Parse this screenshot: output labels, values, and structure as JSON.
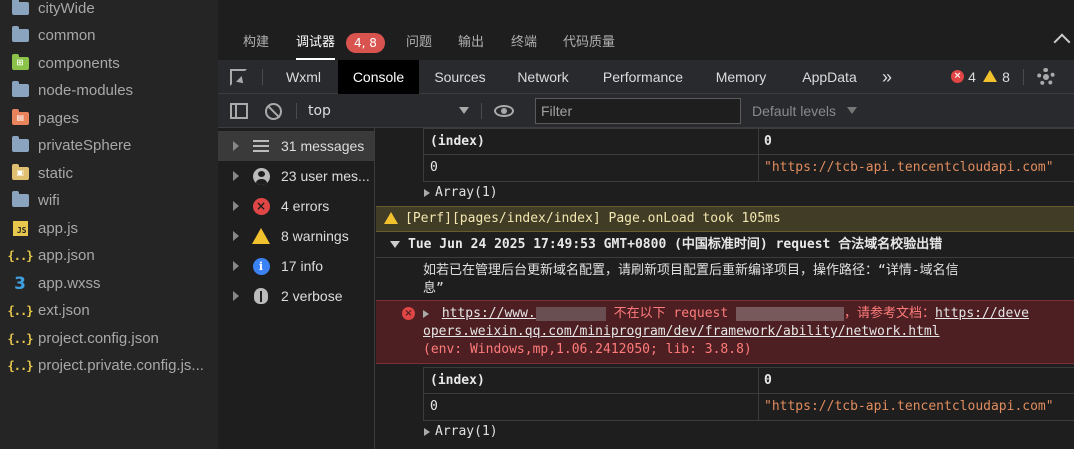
{
  "file_tree": [
    {
      "name": "cityWide",
      "icon": "folder-icon",
      "color": "blue"
    },
    {
      "name": "common",
      "icon": "folder-icon",
      "color": "blue"
    },
    {
      "name": "components",
      "icon": "components-folder-icon",
      "color": "green"
    },
    {
      "name": "node-modules",
      "icon": "folder-icon",
      "color": "blue"
    },
    {
      "name": "pages",
      "icon": "pages-folder-icon",
      "color": "orange"
    },
    {
      "name": "privateSphere",
      "icon": "folder-icon",
      "color": "blue"
    },
    {
      "name": "static",
      "icon": "static-folder-icon",
      "color": "yellow"
    },
    {
      "name": "wifi",
      "icon": "folder-icon",
      "color": "blue"
    },
    {
      "name": "app.js",
      "icon": "js-file-icon"
    },
    {
      "name": "app.json",
      "icon": "json-file-icon"
    },
    {
      "name": "app.wxss",
      "icon": "css-file-icon"
    },
    {
      "name": "ext.json",
      "icon": "json-file-icon"
    },
    {
      "name": "project.config.json",
      "icon": "json-file-icon"
    },
    {
      "name": "project.private.config.js...",
      "icon": "json-file-icon"
    }
  ],
  "panel_tabs": {
    "build": "构建",
    "debugger": "调试器",
    "debugger_badge": "4, 8",
    "problems": "问题",
    "output": "输出",
    "terminal": "终端",
    "code_quality": "代码质量"
  },
  "devtools_tabs": {
    "wxml": "Wxml",
    "console": "Console",
    "sources": "Sources",
    "network": "Network",
    "performance": "Performance",
    "memory": "Memory",
    "appdata": "AppData",
    "more": "»",
    "error_count": "4",
    "warning_count": "8"
  },
  "filter_bar": {
    "context": "top",
    "filter_placeholder": "Filter",
    "levels": "Default levels"
  },
  "categories": [
    {
      "label": "31 messages",
      "icon": "list-icon"
    },
    {
      "label": "23 user mes...",
      "icon": "user-icon"
    },
    {
      "label": "4 errors",
      "icon": "error-icon"
    },
    {
      "label": "8 warnings",
      "icon": "warning-icon"
    },
    {
      "label": "17 info",
      "icon": "info-icon"
    },
    {
      "label": "2 verbose",
      "icon": "bug-icon"
    }
  ],
  "console": {
    "table1": {
      "h_index": "(index)",
      "h_value": "0",
      "r_index": "0",
      "r_value": "\"https://tcb-api.tencentcloudapi.com\""
    },
    "array1": "Array(1)",
    "perf_warning": "[Perf][pages/index/index] Page.onLoad took 105ms",
    "group_header": "Tue Jun 24 2025 17:49:53 GMT+0800 (中国标准时间) request 合法域名校验出错",
    "group_msg_1": "如若已在管理后台更新域名配置，请刷新项目配置后重新编译项目，操作路径：“详情-域名信",
    "group_msg_2": "息”",
    "error_url_prefix": "https://www.",
    "error_text_1": " 不在以下 request ",
    "error_text_2": "，请参考文档：",
    "error_doc_start": "https://deve",
    "error_doc_line2": "opers.weixin.qq.com/miniprogram/dev/framework/ability/network.html",
    "error_env": "(env: Windows,mp,1.06.2412050; lib: 3.8.8)",
    "table2": {
      "h_index": "(index)",
      "h_value": "0",
      "r_index": "0",
      "r_value": "\"https://tcb-api.tencentcloudapi.com\""
    },
    "array2": "Array(1)"
  }
}
